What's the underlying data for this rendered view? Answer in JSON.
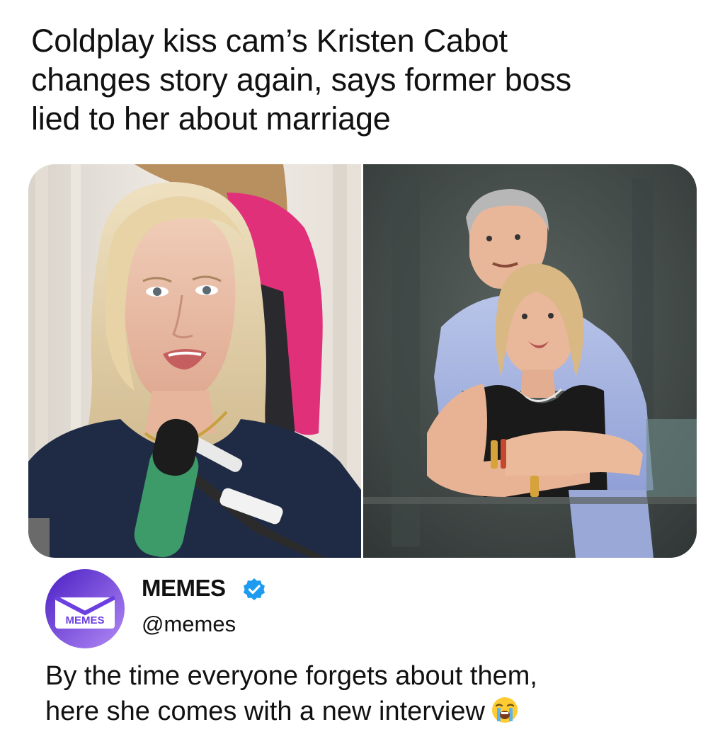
{
  "headline": {
    "line1": "Coldplay kiss cam’s Kristen Cabot",
    "line2": "changes story again, says former boss",
    "line3": "lied to her about marriage"
  },
  "photos": {
    "left_icon": "woman-speaking-into-microphone-image",
    "right_icon": "kiss-cam-couple-embracing-image"
  },
  "tweet": {
    "avatar_label": "MEMES",
    "display_name": "MEMES",
    "handle": "@memes",
    "verified_icon": "verified-badge-icon",
    "text_line1": "By the time everyone forgets about them,",
    "text_line2": "here she comes with a new interview",
    "emoji_icon": "loudly-crying-face-emoji"
  },
  "colors": {
    "verified_blue": "#1d9bf0",
    "avatar_purple_dark": "#5b2bd6",
    "avatar_purple_light": "#a67cf2",
    "jacket_pink": "#e0307a",
    "mic_green": "#3d9b6a"
  }
}
